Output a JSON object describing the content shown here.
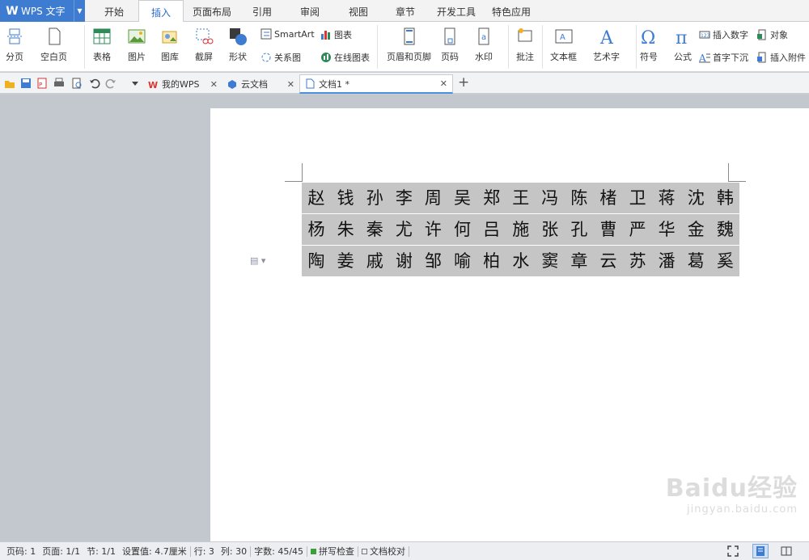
{
  "app": {
    "title": "WPS 文字"
  },
  "menu": {
    "tabs": [
      "开始",
      "插入",
      "页面布局",
      "引用",
      "审阅",
      "视图",
      "章节",
      "开发工具",
      "特色应用"
    ],
    "active": "插入"
  },
  "ribbon": {
    "page_break": "分页",
    "blank_page": "空白页",
    "table": "表格",
    "picture": "图片",
    "gallery": "图库",
    "screenshot": "截屏",
    "shapes": "形状",
    "smartart": "SmartArt",
    "chart": "图表",
    "relation": "关系图",
    "online_chart": "在线图表",
    "header_footer": "页眉和页脚",
    "page_number": "页码",
    "watermark": "水印",
    "comment": "批注",
    "textbox": "文本框",
    "wordart": "艺术字",
    "symbol": "符号",
    "formula": "公式",
    "insert_number": "插入数字",
    "object": "对象",
    "drop_cap": "首字下沉",
    "attachment": "插入附件"
  },
  "doc_tabs": [
    {
      "label": "我的WPS"
    },
    {
      "label": "云文档"
    },
    {
      "label": "文档1 *"
    }
  ],
  "document": {
    "lines": [
      [
        "赵",
        "钱",
        "孙",
        "李",
        "周",
        "吴",
        "郑",
        "王",
        "冯",
        "陈",
        "楮",
        "卫",
        "蒋",
        "沈",
        "韩"
      ],
      [
        "杨",
        "朱",
        "秦",
        "尤",
        "许",
        "何",
        "吕",
        "施",
        "张",
        "孔",
        "曹",
        "严",
        "华",
        "金",
        "魏"
      ],
      [
        "陶",
        "姜",
        "戚",
        "谢",
        "邹",
        "喻",
        "柏",
        "水",
        "窦",
        "章",
        "云",
        "苏",
        "潘",
        "葛",
        "奚"
      ]
    ],
    "selection_color": "#c5c5c5"
  },
  "status": {
    "page_num": "页码: 1",
    "pages": "页面: 1/1",
    "section": "节: 1/1",
    "setting": "设置值: 4.7厘米",
    "row": "行: 3",
    "col": "列: 30",
    "words": "字数: 45/45",
    "spell": "拼写检查",
    "proof": "文档校对"
  },
  "watermark_text": {
    "big": "Baidu经验",
    "small": "jingyan.baidu.com"
  },
  "colors": {
    "accent": "#3d7cd1",
    "tab_active": "#2a6acb",
    "workspace": "#c3c7ce"
  }
}
